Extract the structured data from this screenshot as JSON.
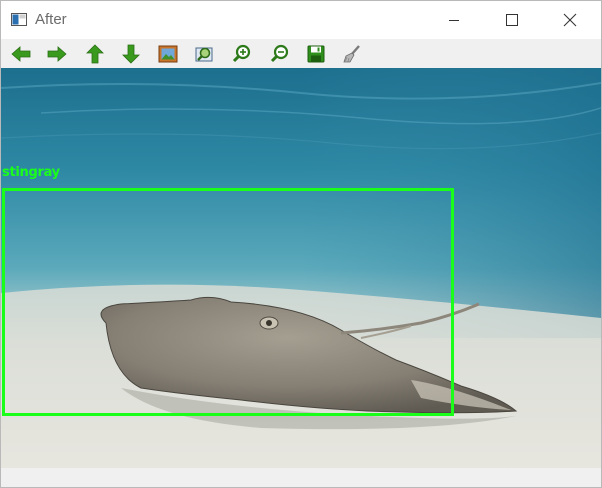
{
  "window": {
    "title": "After",
    "controls": {
      "minimize": "minimize",
      "maximize": "maximize",
      "close": "close"
    }
  },
  "toolbar": {
    "buttons": [
      {
        "name": "pan-left",
        "icon": "arrow-left-icon"
      },
      {
        "name": "pan-right",
        "icon": "arrow-right-icon"
      },
      {
        "name": "pan-up",
        "icon": "arrow-up-icon"
      },
      {
        "name": "pan-down",
        "icon": "arrow-down-icon"
      },
      {
        "name": "zoom-fit",
        "icon": "picture-icon"
      },
      {
        "name": "zoom-region",
        "icon": "zoom-region-icon"
      },
      {
        "name": "zoom-in",
        "icon": "zoom-in-icon"
      },
      {
        "name": "zoom-out",
        "icon": "zoom-out-icon"
      },
      {
        "name": "save",
        "icon": "floppy-disk-icon"
      },
      {
        "name": "properties",
        "icon": "brush-icon"
      }
    ]
  },
  "image": {
    "detection": {
      "label": "stingray",
      "color": "#1aff1a"
    }
  },
  "colors": {
    "toolbar_icon_green": "#3a9a1e",
    "detection_box": "#1aff1a"
  }
}
